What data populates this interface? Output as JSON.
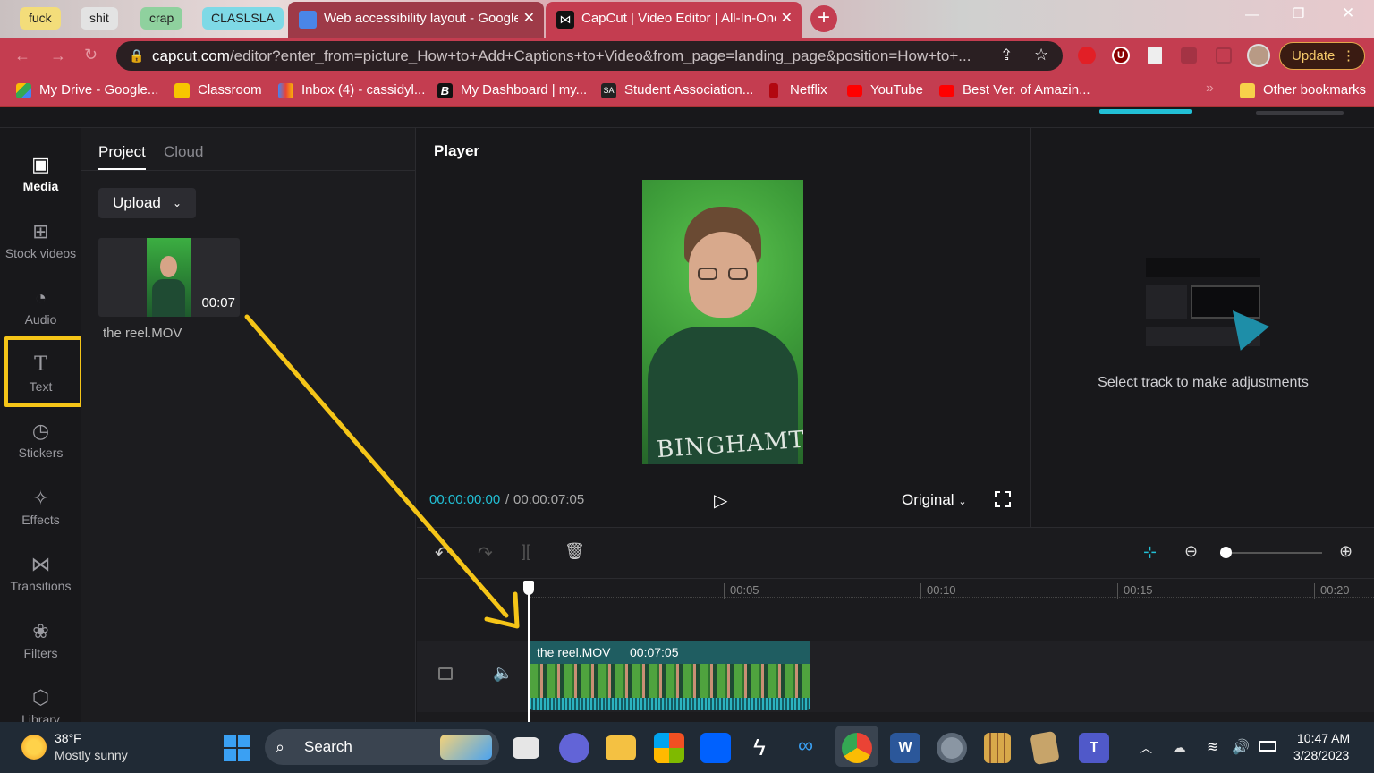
{
  "browser": {
    "tab_groups": [
      {
        "label": "fuck",
        "color": "#f3dd7a"
      },
      {
        "label": "shit",
        "color": "#e3e3e3"
      },
      {
        "label": "crap",
        "color": "#8fd19e"
      },
      {
        "label": "CLASLSLA",
        "color": "#7ed9e6"
      }
    ],
    "tabs": [
      {
        "title": "Web accessibility layout - Google",
        "icon": "google-docs-icon",
        "active": false
      },
      {
        "title": "CapCut | Video Editor | All-In-One",
        "icon": "capcut-icon",
        "active": true
      }
    ],
    "new_tab_label": "+",
    "url_domain": "capcut.com",
    "url_path": "/editor?enter_from=picture_How+to+Add+Captions+to+Video&from_page=landing_page&position=How+to+...",
    "update_label": "Update",
    "bookmarks": [
      {
        "label": "My Drive - Google...",
        "icon": "google-drive-icon"
      },
      {
        "label": "Classroom",
        "icon": "classroom-icon"
      },
      {
        "label": "Inbox (4) - cassidyl...",
        "icon": "gmail-icon"
      },
      {
        "label": "My Dashboard | my...",
        "icon": "b-logo-icon"
      },
      {
        "label": "Student Association...",
        "icon": "sa-logo-icon"
      },
      {
        "label": "Netflix",
        "icon": "netflix-icon"
      },
      {
        "label": "YouTube",
        "icon": "youtube-icon"
      },
      {
        "label": "Best Ver. of Amazin...",
        "icon": "youtube-icon"
      }
    ],
    "other_bookmarks": "Other bookmarks"
  },
  "sidebar": {
    "items": [
      {
        "label": "Media",
        "icon": "media-icon",
        "active": true
      },
      {
        "label": "Stock videos",
        "icon": "stock-videos-icon"
      },
      {
        "label": "Audio",
        "icon": "audio-icon"
      },
      {
        "label": "Text",
        "icon": "text-icon",
        "highlighted": true
      },
      {
        "label": "Stickers",
        "icon": "stickers-icon"
      },
      {
        "label": "Effects",
        "icon": "effects-icon"
      },
      {
        "label": "Transitions",
        "icon": "transitions-icon"
      },
      {
        "label": "Filters",
        "icon": "filters-icon"
      },
      {
        "label": "Library",
        "icon": "library-icon"
      }
    ]
  },
  "media": {
    "tabs": [
      "Project",
      "Cloud"
    ],
    "upload_label": "Upload",
    "clip": {
      "duration": "00:07",
      "name": "the reel.MOV"
    }
  },
  "player": {
    "title": "Player",
    "current_time": "00:00:00:00",
    "separator": "/",
    "total_time": "00:00:07:05",
    "ratio_label": "Original"
  },
  "adjust": {
    "hint": "Select track to make adjustments"
  },
  "timeline": {
    "ruler": [
      "00:05",
      "00:10",
      "00:15",
      "00:20"
    ],
    "clip_name": "the reel.MOV",
    "clip_duration": "00:07:05",
    "zoom_level": 0.05
  },
  "taskbar": {
    "weather_temp": "38°F",
    "weather_desc": "Mostly sunny",
    "search_label": "Search",
    "time": "10:47 AM",
    "date": "3/28/2023"
  },
  "colors": {
    "accent": "#22c0d6",
    "annotation": "#f5c518",
    "chrome_red": "#c43d50"
  }
}
